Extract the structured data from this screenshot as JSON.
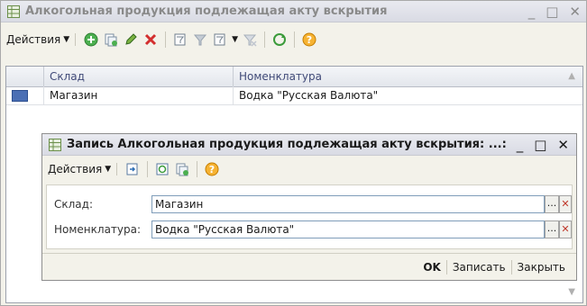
{
  "main_window": {
    "title": "Алкогольная продукция подлежащая акту вскрытия",
    "controls": {
      "minimize": "_",
      "maximize": "□",
      "close": "✕"
    },
    "toolbar": {
      "actions_label": "Действия",
      "icons": [
        "add-icon",
        "copy-icon",
        "edit-icon",
        "delete-icon",
        "filter-icon",
        "filter-off-icon",
        "filter-list-icon",
        "clear-filter-icon",
        "refresh-icon",
        "help-icon"
      ]
    },
    "grid": {
      "columns": [
        "Склад",
        "Номенклатура"
      ],
      "rows": [
        {
          "warehouse": "Магазин",
          "item": "Водка \"Русская Валюта\""
        }
      ]
    }
  },
  "dialog": {
    "title": "Запись Алкогольная продукция подлежащая акту вскрытия: ...:",
    "controls": {
      "minimize": "_",
      "maximize": "□",
      "close": "✕"
    },
    "toolbar": {
      "actions_label": "Действия",
      "icons": [
        "save-close-icon",
        "refresh-icon",
        "copy-icon",
        "help-icon"
      ]
    },
    "fields": {
      "warehouse_label": "Склад:",
      "warehouse_value": "Магазин",
      "item_label": "Номенклатура:",
      "item_value": "Водка \"Русская Валюта\"",
      "select_button": "...",
      "clear_button": "✕"
    },
    "buttons": {
      "ok": "OK",
      "write": "Записать",
      "close": "Закрыть"
    }
  }
}
